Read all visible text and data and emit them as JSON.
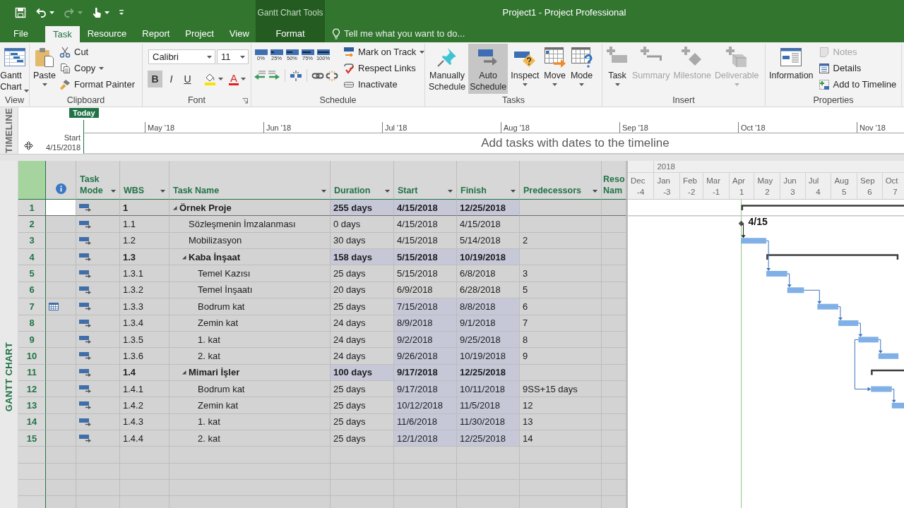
{
  "quick_access": [
    {
      "kind": "save",
      "disabled": false,
      "menu": false
    },
    {
      "kind": "undo",
      "disabled": false,
      "menu": true
    },
    {
      "kind": "redo",
      "disabled": true,
      "menu": true
    },
    {
      "kind": "touch",
      "disabled": false,
      "menu": true
    },
    {
      "kind": "customize",
      "disabled": false,
      "menu": false
    }
  ],
  "window": {
    "title": "Project1 - Project Professional",
    "context_group": "Gantt Chart Tools"
  },
  "tabs": [
    {
      "label": "File",
      "selected": false,
      "contextual": false
    },
    {
      "label": "Task",
      "selected": true,
      "contextual": false
    },
    {
      "label": "Resource",
      "selected": false,
      "contextual": false
    },
    {
      "label": "Report",
      "selected": false,
      "contextual": false
    },
    {
      "label": "Project",
      "selected": false,
      "contextual": false
    },
    {
      "label": "View",
      "selected": false,
      "contextual": false
    },
    {
      "label": "Format",
      "selected": false,
      "contextual": true
    }
  ],
  "tell_me": {
    "placeholder": "Tell me what you want to do..."
  },
  "ribbon": {
    "groups": [
      {
        "kind": "view",
        "label": "View",
        "large": [
          {
            "label": "Gantt Chart",
            "menu": true
          }
        ]
      },
      {
        "kind": "clipboard",
        "label": "Clipboard",
        "large": [
          {
            "label": "Paste",
            "menu": true
          }
        ],
        "small": [
          {
            "label": "Cut",
            "menu": false,
            "disabled": false
          },
          {
            "label": "Copy",
            "menu": true,
            "disabled": false
          },
          {
            "label": "Format Painter",
            "menu": false,
            "disabled": false
          }
        ]
      },
      {
        "kind": "font",
        "label": "Font",
        "launcher": true,
        "font_name": "Calibri",
        "font_size": "11",
        "styles": [
          {
            "kind": "bold",
            "label": "B",
            "selected": true
          },
          {
            "kind": "italic",
            "label": "I",
            "selected": false
          },
          {
            "kind": "underline",
            "label": "U",
            "selected": false
          }
        ],
        "highlight": {
          "menu": true
        },
        "font_color": {
          "label": "A",
          "menu": true
        }
      },
      {
        "kind": "schedule",
        "label": "Schedule",
        "progress": [
          "0%",
          "25%",
          "50%",
          "75%",
          "100%"
        ],
        "small": [
          {
            "label": "Mark on Track",
            "menu": true,
            "disabled": false
          },
          {
            "label": "Respect Links",
            "menu": false,
            "disabled": false
          },
          {
            "label": "Inactivate",
            "menu": false,
            "disabled": false
          }
        ]
      },
      {
        "kind": "tasks",
        "label": "Tasks",
        "large": [
          {
            "label": "Manually Schedule",
            "selected": false,
            "menu": false
          },
          {
            "label": "Auto Schedule",
            "selected": true,
            "menu": false
          },
          {
            "label": "Inspect",
            "selected": false,
            "menu": true
          },
          {
            "label": "Move",
            "selected": false,
            "menu": true
          },
          {
            "label": "Mode",
            "selected": false,
            "menu": true
          }
        ]
      },
      {
        "kind": "insert",
        "label": "Insert",
        "large": [
          {
            "label": "Task",
            "disabled": false,
            "menu": true
          },
          {
            "label": "Summary",
            "disabled": true,
            "menu": false
          },
          {
            "label": "Milestone",
            "disabled": true,
            "menu": false
          },
          {
            "label": "Deliverable",
            "disabled": true,
            "menu": true
          }
        ]
      },
      {
        "kind": "properties",
        "label": "Properties",
        "large": [
          {
            "label": "Information",
            "menu": false
          }
        ],
        "small": [
          {
            "label": "Notes",
            "menu": false,
            "disabled": true
          },
          {
            "label": "Details",
            "menu": false,
            "disabled": false
          },
          {
            "label": "Add to Timeline",
            "menu": false,
            "disabled": false
          }
        ]
      }
    ]
  },
  "timeline": {
    "label": "TIMELINE",
    "today": "Today",
    "start_label": "Start",
    "start_date": "4/15/2018",
    "months": [
      "May '18",
      "Jun '18",
      "Jul '18",
      "Aug '18",
      "Sep '18",
      "Oct '18",
      "Nov '18"
    ],
    "message": "Add tasks with dates to the timeline"
  },
  "view": {
    "label": "GANTT CHART"
  },
  "table": {
    "columns": [
      {
        "kind": "indicators",
        "filter": false
      },
      {
        "kind": "mode",
        "label": "Task Mode",
        "filter": true
      },
      {
        "kind": "wbs",
        "label": "WBS",
        "filter": true
      },
      {
        "kind": "name",
        "label": "Task Name",
        "filter": true
      },
      {
        "kind": "duration",
        "label": "Duration",
        "filter": true
      },
      {
        "kind": "start",
        "label": "Start",
        "filter": true
      },
      {
        "kind": "finish",
        "label": "Finish",
        "filter": true
      },
      {
        "kind": "predecessors",
        "label": "Predecessors",
        "filter": true
      },
      {
        "kind": "cut",
        "label": "Reso Nam"
      }
    ],
    "tasks": [
      {
        "row": "1",
        "wbs": "1",
        "name": "Örnek Proje",
        "kind": "summary",
        "expanded": true,
        "selected": true,
        "constraint": false,
        "duration": "255 days",
        "start": "4/15/2018",
        "finish": "12/25/2018",
        "duration_highlighted": true,
        "start_highlighted": true,
        "finish_highlighted": true,
        "children": [
          {
            "row": "2",
            "wbs": "1.1",
            "name": "Sözleşmenin İmzalanması",
            "kind": "milestone",
            "selected": false,
            "constraint": false,
            "duration": "0 days",
            "start": "4/15/2018",
            "finish": "4/15/2018",
            "duration_highlighted": false,
            "start_highlighted": false,
            "finish_highlighted": false,
            "bar_label": "4/15"
          },
          {
            "row": "3",
            "wbs": "1.2",
            "name": "Mobilizasyon",
            "kind": "task",
            "selected": false,
            "constraint": false,
            "duration": "30 days",
            "start": "4/15/2018",
            "finish": "5/14/2018",
            "predecessors": "2",
            "duration_highlighted": false,
            "start_highlighted": false,
            "finish_highlighted": false
          },
          {
            "row": "4",
            "wbs": "1.3",
            "name": "Kaba İnşaat",
            "kind": "summary",
            "expanded": true,
            "selected": false,
            "constraint": false,
            "duration": "158 days",
            "start": "5/15/2018",
            "finish": "10/19/2018",
            "duration_highlighted": true,
            "start_highlighted": true,
            "finish_highlighted": true,
            "children": [
              {
                "row": "5",
                "wbs": "1.3.1",
                "name": "Temel Kazısı",
                "kind": "task",
                "selected": false,
                "constraint": false,
                "duration": "25 days",
                "start": "5/15/2018",
                "finish": "6/8/2018",
                "predecessors": "3",
                "duration_highlighted": false,
                "start_highlighted": false,
                "finish_highlighted": false
              },
              {
                "row": "6",
                "wbs": "1.3.2",
                "name": "Temel İnşaatı",
                "kind": "task",
                "selected": false,
                "constraint": false,
                "duration": "20 days",
                "start": "6/9/2018",
                "finish": "6/28/2018",
                "predecessors": "5",
                "duration_highlighted": false,
                "start_highlighted": false,
                "finish_highlighted": false
              },
              {
                "row": "7",
                "wbs": "1.3.3",
                "name": "Bodrum kat",
                "kind": "task",
                "selected": false,
                "constraint": true,
                "duration": "25 days",
                "start": "7/15/2018",
                "finish": "8/8/2018",
                "predecessors": "6",
                "duration_highlighted": false,
                "start_highlighted": true,
                "finish_highlighted": true
              },
              {
                "row": "8",
                "wbs": "1.3.4",
                "name": "Zemin kat",
                "kind": "task",
                "selected": false,
                "constraint": false,
                "duration": "24 days",
                "start": "8/9/2018",
                "finish": "9/1/2018",
                "predecessors": "7",
                "duration_highlighted": false,
                "start_highlighted": true,
                "finish_highlighted": true
              },
              {
                "row": "9",
                "wbs": "1.3.5",
                "name": "1. kat",
                "kind": "task",
                "selected": false,
                "constraint": false,
                "duration": "24 days",
                "start": "9/2/2018",
                "finish": "9/25/2018",
                "predecessors": "8",
                "duration_highlighted": false,
                "start_highlighted": true,
                "finish_highlighted": true
              },
              {
                "row": "10",
                "wbs": "1.3.6",
                "name": "2. kat",
                "kind": "task",
                "selected": false,
                "constraint": false,
                "duration": "24 days",
                "start": "9/26/2018",
                "finish": "10/19/2018",
                "predecessors": "9",
                "duration_highlighted": false,
                "start_highlighted": true,
                "finish_highlighted": true
              }
            ]
          },
          {
            "row": "11",
            "wbs": "1.4",
            "name": "Mimari İşler",
            "kind": "summary",
            "expanded": true,
            "selected": false,
            "constraint": false,
            "duration": "100 days",
            "start": "9/17/2018",
            "finish": "12/25/2018",
            "duration_highlighted": true,
            "start_highlighted": true,
            "finish_highlighted": true,
            "children": [
              {
                "row": "12",
                "wbs": "1.4.1",
                "name": "Bodrum kat",
                "kind": "task",
                "selected": false,
                "constraint": false,
                "duration": "25 days",
                "start": "9/17/2018",
                "finish": "10/11/2018",
                "predecessors": "9SS+15 days",
                "duration_highlighted": false,
                "start_highlighted": true,
                "finish_highlighted": true
              },
              {
                "row": "13",
                "wbs": "1.4.2",
                "name": "Zemin kat",
                "kind": "task",
                "selected": false,
                "constraint": false,
                "duration": "25 days",
                "start": "10/12/2018",
                "finish": "11/5/2018",
                "predecessors": "12",
                "duration_highlighted": false,
                "start_highlighted": true,
                "finish_highlighted": true
              },
              {
                "row": "14",
                "wbs": "1.4.3",
                "name": "1. kat",
                "kind": "task",
                "selected": false,
                "constraint": false,
                "duration": "25 days",
                "start": "11/6/2018",
                "finish": "11/30/2018",
                "predecessors": "13",
                "duration_highlighted": false,
                "start_highlighted": true,
                "finish_highlighted": true
              },
              {
                "row": "15",
                "wbs": "1.4.4",
                "name": "2. kat",
                "kind": "task",
                "selected": false,
                "constraint": false,
                "duration": "25 days",
                "start": "12/1/2018",
                "finish": "12/25/2018",
                "predecessors": "14",
                "duration_highlighted": false,
                "start_highlighted": true,
                "finish_highlighted": true
              }
            ]
          }
        ]
      }
    ]
  },
  "chart": {
    "timescale": {
      "year": "2018",
      "months": [
        {
          "label": "Dec",
          "number": "-4"
        },
        {
          "label": "Jan",
          "number": "-3"
        },
        {
          "label": "Feb",
          "number": "-2"
        },
        {
          "label": "Mar",
          "number": "-1"
        },
        {
          "label": "Apr",
          "number": "1"
        },
        {
          "label": "May",
          "number": "2"
        },
        {
          "label": "Jun",
          "number": "3"
        },
        {
          "label": "Jul",
          "number": "4"
        },
        {
          "label": "Aug",
          "number": "5"
        },
        {
          "label": "Sep",
          "number": "6"
        },
        {
          "label": "Oct",
          "number": "7"
        }
      ]
    }
  }
}
